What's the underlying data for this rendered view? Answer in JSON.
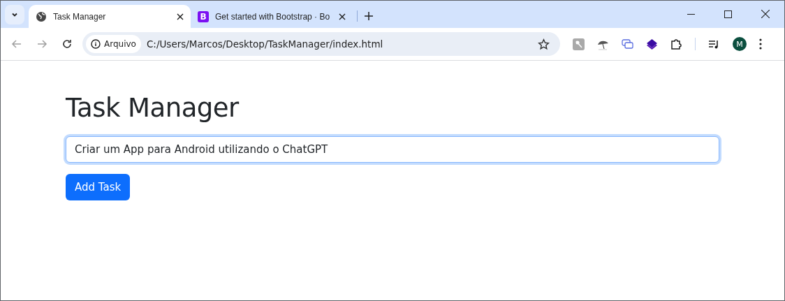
{
  "tabs": [
    {
      "title": "Task Manager",
      "kind": "globe",
      "selected": true
    },
    {
      "title": "Get started with Bootstrap · Bo",
      "kind": "letter",
      "favicon_text": "B",
      "selected": false
    }
  ],
  "address_bar": {
    "badge": "Arquivo",
    "url": "C:/Users/Marcos/Desktop/TaskManager/index.html"
  },
  "profile": {
    "initial": "M"
  },
  "page": {
    "heading": "Task Manager",
    "task_input": {
      "value": "Criar um App para Android utilizando o ChatGPT",
      "focused": true
    },
    "add_button": "Add Task"
  }
}
